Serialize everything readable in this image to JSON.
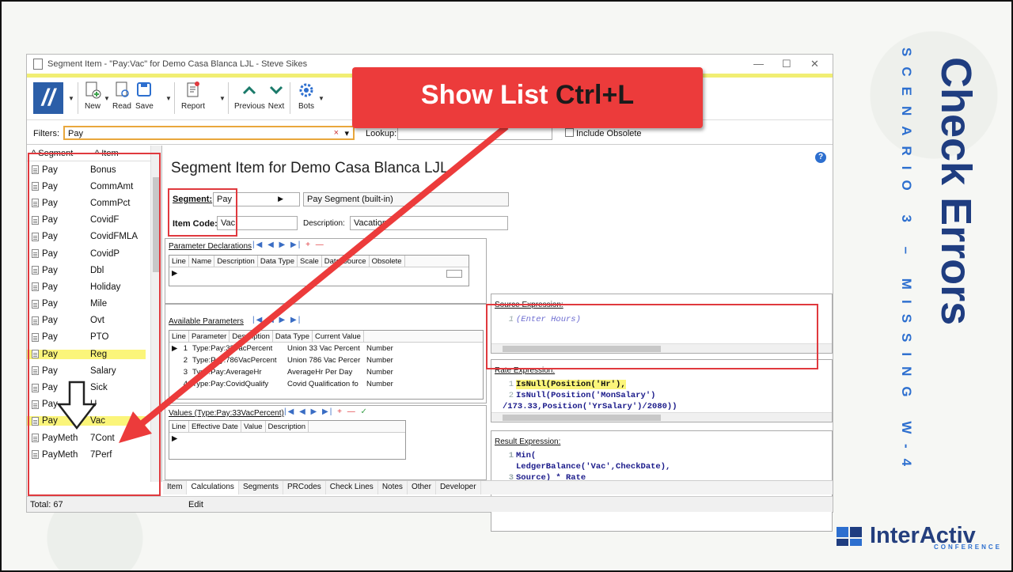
{
  "window": {
    "title": "Segment Item - \"Pay:Vac\" for Demo Casa Blanca LJL - Steve Sikes",
    "minimize": "—",
    "maximize": "☐",
    "close": "✕"
  },
  "ribbon": {
    "new": "New",
    "read": "Read",
    "save": "Save",
    "report": "Report",
    "previous": "Previous",
    "next": "Next",
    "bots": "Bots"
  },
  "filters": {
    "label": "Filters:",
    "value": "Pay",
    "clear": "×",
    "dropdown": "▾",
    "lookup_label": "Lookup:",
    "lookup_value": "",
    "include_obsolete": "Include Obsolete"
  },
  "list": {
    "col_segment": "Segment",
    "col_item": "Item",
    "sort_glyph": "^",
    "rows": [
      {
        "segment": "Pay",
        "item": "Bonus"
      },
      {
        "segment": "Pay",
        "item": "CommAmt"
      },
      {
        "segment": "Pay",
        "item": "CommPct"
      },
      {
        "segment": "Pay",
        "item": "CovidF"
      },
      {
        "segment": "Pay",
        "item": "CovidFMLA"
      },
      {
        "segment": "Pay",
        "item": "CovidP"
      },
      {
        "segment": "Pay",
        "item": "Dbl"
      },
      {
        "segment": "Pay",
        "item": "Holiday"
      },
      {
        "segment": "Pay",
        "item": "Mile"
      },
      {
        "segment": "Pay",
        "item": "Ovt"
      },
      {
        "segment": "Pay",
        "item": "PTO"
      },
      {
        "segment": "Pay",
        "item": "Reg"
      },
      {
        "segment": "Pay",
        "item": "Salary"
      },
      {
        "segment": "Pay",
        "item": "Sick"
      },
      {
        "segment": "Pay",
        "item": "U"
      },
      {
        "segment": "Pay",
        "item": "Vac"
      },
      {
        "segment": "PayMeth",
        "item": "7Cont"
      },
      {
        "segment": "PayMeth",
        "item": "7Perf"
      }
    ],
    "total": "Total: 67"
  },
  "main": {
    "heading": "Segment Item for Demo Casa Blanca LJL",
    "segment_label": "Segment:",
    "segment_value": "Pay",
    "segment_desc": "Pay Segment (built-in)",
    "itemcode_label": "Item Code:",
    "itemcode_value": "Vac",
    "description_label": "Description:",
    "description_value": "Vacation",
    "param_decl_title": "Parameter Declarations",
    "param_decl_cols": [
      "Line",
      "Name",
      "Description",
      "Data Type",
      "Scale",
      "Date Source",
      "Obsolete"
    ],
    "avail_title": "Available Parameters",
    "avail_cols": [
      "Line",
      "Parameter",
      "Description",
      "Data Type",
      "Current Value"
    ],
    "avail_rows": [
      {
        "line": "1",
        "param": "Type:Pay:33VacPercent",
        "desc": "Union 33 Vac Percent",
        "type": "Number"
      },
      {
        "line": "2",
        "param": "Type:Pay:786VacPercent",
        "desc": "Union 786 Vac Percer",
        "type": "Number"
      },
      {
        "line": "3",
        "param": "Type:Pay:AverageHr",
        "desc": "AverageHr Per Day",
        "type": "Number"
      },
      {
        "line": "4",
        "param": "Type:Pay:CovidQualify",
        "desc": "Covid Qualification fo",
        "type": "Number"
      }
    ],
    "values_title": "Values (Type:Pay:33VacPercent)",
    "values_cols": [
      "Line",
      "Effective Date",
      "Value",
      "Description"
    ],
    "source_title": "Source Expression:",
    "source_lines": [
      "(Enter Hours)"
    ],
    "rate_title": "Rate Expression:",
    "rate_lines": [
      "IsNull(Position('Hr'),",
      "IsNull(Position('MonSalary') /173.33,Position('YrSalary')/2080))"
    ],
    "result_title": "Result Expression:",
    "result_lines": [
      "Min(",
      "LedgerBalance('Vac',CheckDate),",
      "Source) * Rate"
    ],
    "help": "?"
  },
  "tabs": [
    "Item",
    "Calculations",
    "Segments",
    "PRCodes",
    "Check Lines",
    "Notes",
    "Other",
    "Developer"
  ],
  "edit": "Edit",
  "callout": {
    "text": "Show List ",
    "keys": "Ctrl+L"
  },
  "side": {
    "title": "Check Errors",
    "subtitle": "SCENARIO 3 – MISSING W-4"
  },
  "brand": {
    "name": "InterActiv",
    "sub": "CONFERENCE"
  },
  "colors": {
    "accent": "#ec3b3b",
    "brand": "#1f3d80",
    "highlight": "#fbf57a"
  }
}
